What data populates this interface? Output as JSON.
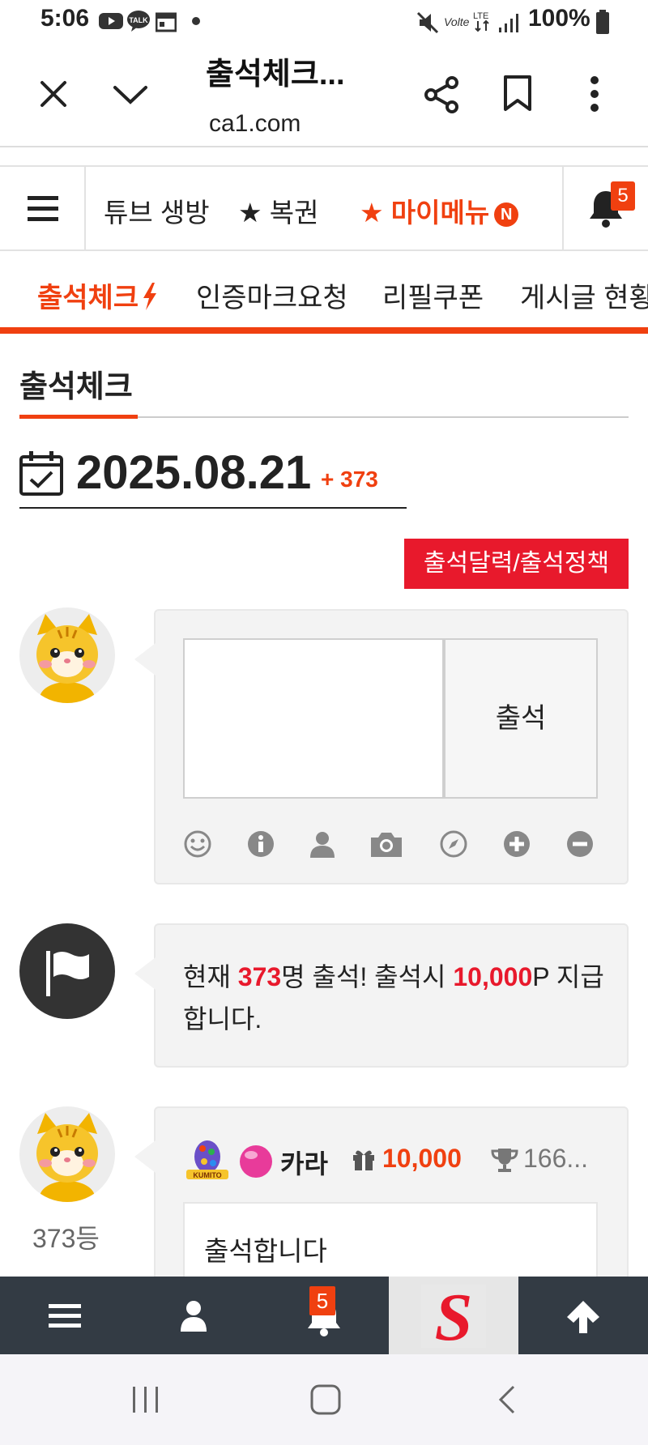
{
  "status_bar": {
    "time": "5:06",
    "battery": "100%",
    "notification_icons": [
      "youtube-icon",
      "kakaotalk-icon",
      "calendar-icon",
      "dot-icon"
    ],
    "system_icons": [
      "mute-icon",
      "volte-icon",
      "lte-icon",
      "signal-icon",
      "battery-icon"
    ],
    "talk_label": "TALK",
    "volte_label": "Volte",
    "lte_label": "LTE"
  },
  "browser": {
    "title": "출석체크...",
    "url": "ca1.com"
  },
  "site_nav": {
    "items": [
      {
        "label": "튜브 생방"
      },
      {
        "label": "★ 복권"
      },
      {
        "label": "★ 마이메뉴"
      }
    ],
    "new_badge": "N",
    "notification_count": "5"
  },
  "sub_nav": {
    "tabs": [
      {
        "label": "출석체크"
      },
      {
        "label": "인증마크요청"
      },
      {
        "label": "리필쿠폰"
      },
      {
        "label": "게시글 현황"
      }
    ]
  },
  "section": {
    "heading": "출석체크"
  },
  "date": {
    "value": "2025.08.21",
    "plus_count": "+ 373"
  },
  "policy_button": "출석달력/출석정책",
  "attend": {
    "textarea_value": "",
    "button_label": "출석"
  },
  "notice": {
    "prefix": "현재 ",
    "count": "373",
    "middle": "명 출석! 출석시 ",
    "points": "10,000",
    "suffix": "P 지급합니다."
  },
  "entry": {
    "rank": "373등",
    "level_badge": "KUMITO",
    "nickname": "카라",
    "points": "10,000",
    "trophy": "166...",
    "comment": "출석합니다"
  },
  "bottom_nav": {
    "notification_count": "5",
    "logo_letter": "S"
  },
  "colors": {
    "accent": "#f04010",
    "red": "#e8192c",
    "dark_nav": "#333b44"
  }
}
